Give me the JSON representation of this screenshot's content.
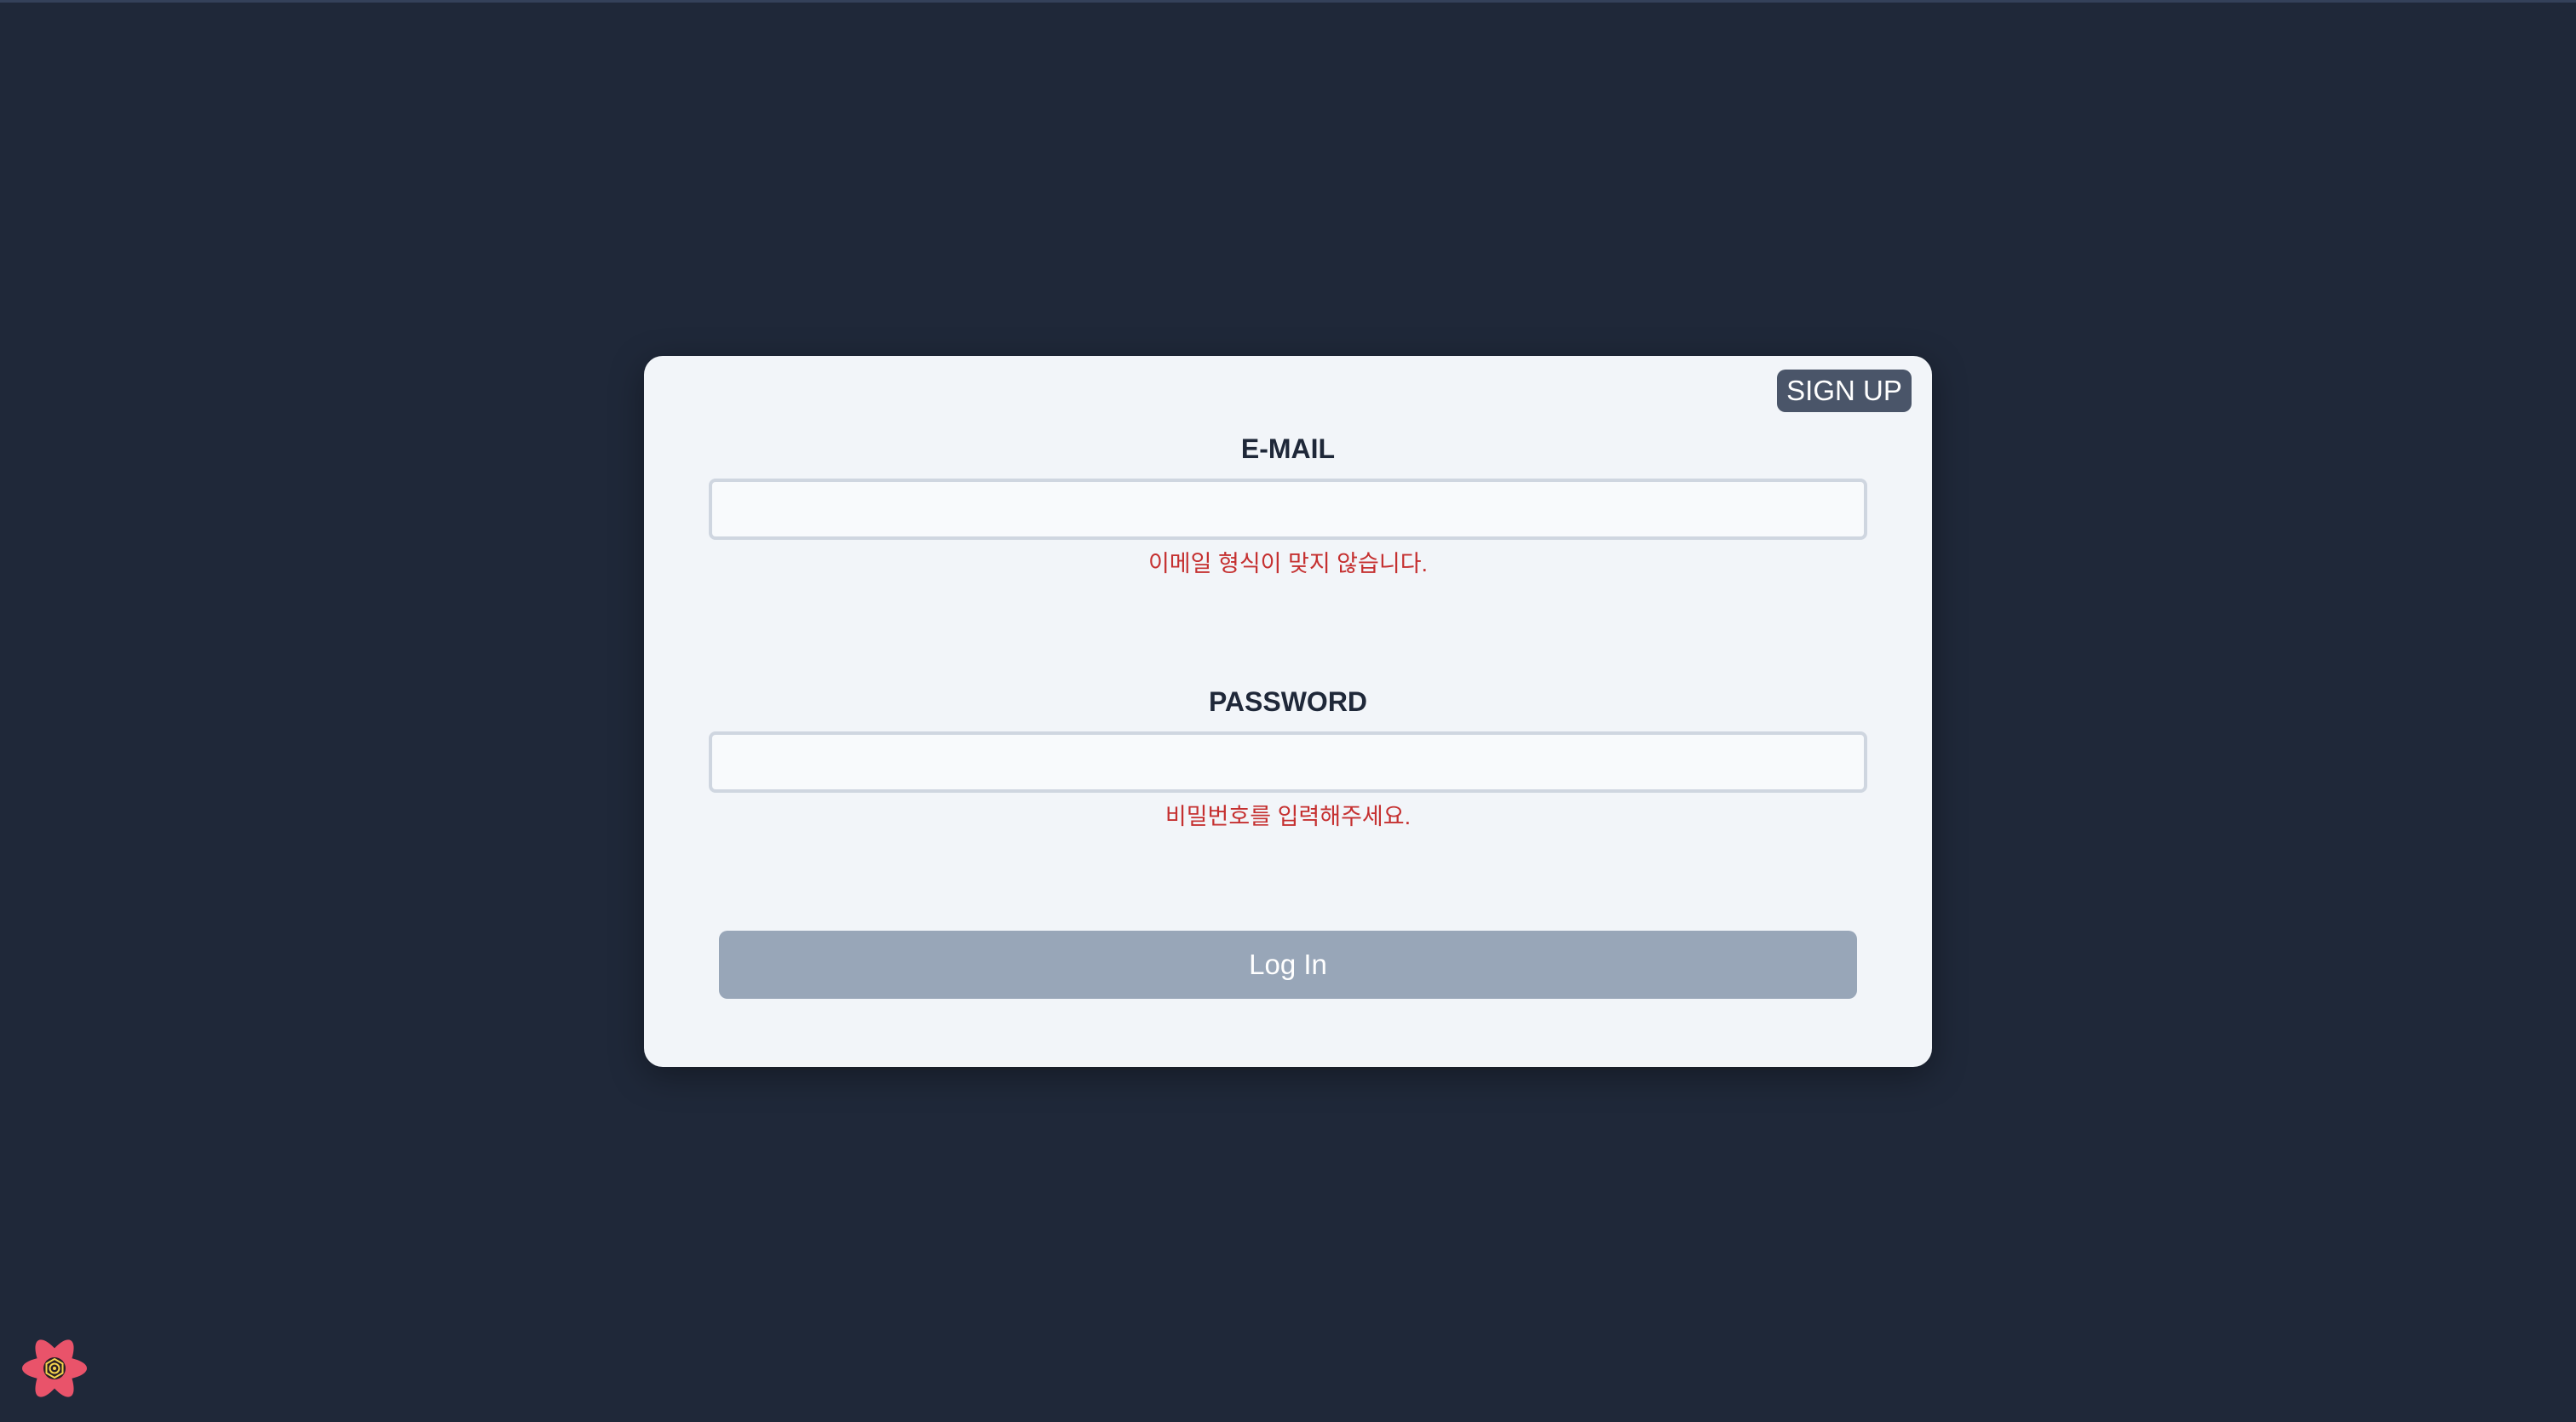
{
  "signup": {
    "label": "SIGN UP"
  },
  "email": {
    "label": "E-MAIL",
    "value": "",
    "placeholder": "",
    "error": "이메일 형식이 맞지 않습니다."
  },
  "password": {
    "label": "PASSWORD",
    "value": "",
    "placeholder": "",
    "error": "비밀번호를 입력해주세요."
  },
  "login": {
    "label": "Log In"
  },
  "devtools": {
    "icon": "react-query-devtools-icon"
  },
  "colors": {
    "background": "#1f2839",
    "card": "#f2f5f9",
    "signup_button": "#4a5569",
    "login_button": "#98a6b8",
    "error_text": "#c53030"
  }
}
